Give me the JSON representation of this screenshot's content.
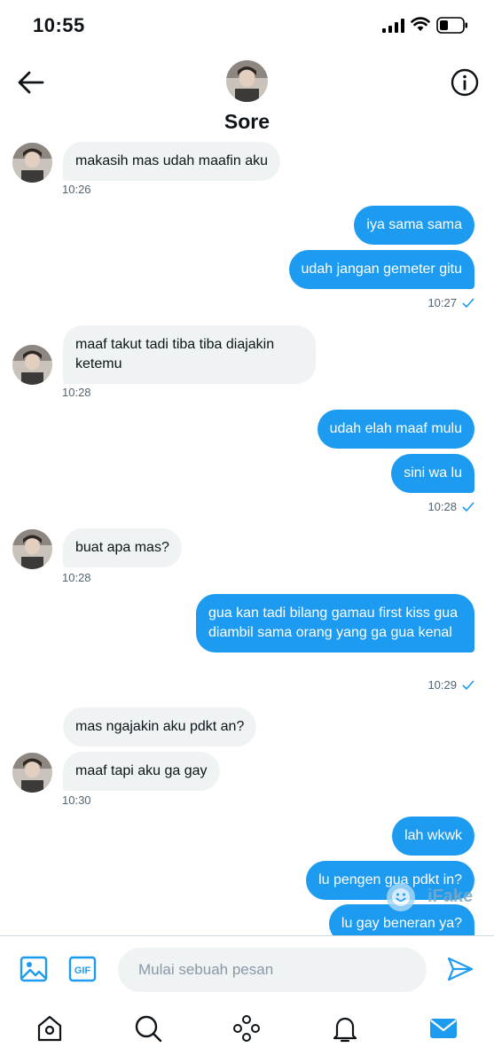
{
  "status_bar": {
    "time": "10:55"
  },
  "header": {
    "name": "Sore"
  },
  "messages": [
    {
      "id": "m1",
      "side": "recv",
      "text": "makasih mas udah maafin aku"
    },
    {
      "id": "t1",
      "time": "10:26"
    },
    {
      "id": "m2",
      "side": "sent",
      "text": "iya sama sama"
    },
    {
      "id": "m3",
      "side": "sent",
      "text": "udah jangan gemeter gitu"
    },
    {
      "id": "t2",
      "time": "10:27"
    },
    {
      "id": "m4",
      "side": "recv",
      "text": "maaf takut tadi tiba tiba diajakin ketemu"
    },
    {
      "id": "t3",
      "time": "10:28"
    },
    {
      "id": "m5",
      "side": "sent",
      "text": "udah elah maaf mulu"
    },
    {
      "id": "m6",
      "side": "sent",
      "text": "sini wa lu"
    },
    {
      "id": "t4",
      "time": "10:28"
    },
    {
      "id": "m7",
      "side": "recv",
      "text": "buat apa mas?"
    },
    {
      "id": "t5",
      "time": "10:28"
    },
    {
      "id": "m8",
      "side": "sent",
      "text": "gua kan tadi bilang gamau first kiss gua diambil sama orang yang ga gua kenal"
    },
    {
      "id": "t6",
      "time": "10:29"
    },
    {
      "id": "m9",
      "side": "recv",
      "text": "mas ngajakin aku pdkt an?"
    },
    {
      "id": "m10",
      "side": "recv",
      "text": "maaf tapi aku ga gay"
    },
    {
      "id": "t7",
      "time": "10:30"
    },
    {
      "id": "m11",
      "side": "sent",
      "text": "lah wkwk"
    },
    {
      "id": "m12",
      "side": "sent",
      "text": "lu pengen gua pdkt in?"
    },
    {
      "id": "m13",
      "side": "sent",
      "text": "lu gay beneran ya?"
    }
  ],
  "watermark": {
    "text": "iFake"
  },
  "composer": {
    "placeholder": "Mulai sebuah pesan",
    "gif_label": "GIF"
  },
  "colors": {
    "accent": "#1d9bf0",
    "bubble_recv": "#eff3f4",
    "text": "#0f1419",
    "muted": "#536471"
  },
  "tabbar": {
    "items": [
      "home-icon",
      "search-icon",
      "spaces-icon",
      "notifications-icon",
      "messages-icon"
    ]
  }
}
